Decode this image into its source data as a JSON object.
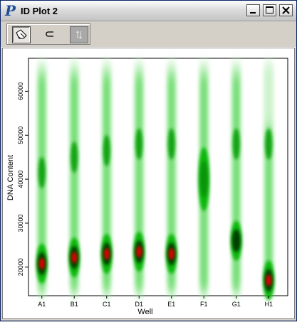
{
  "window": {
    "title": "ID Plot 2",
    "app_icon_letter": "P",
    "controls": [
      "minimize",
      "maximize",
      "close"
    ]
  },
  "toolbar": {
    "buttons": [
      {
        "name": "tag-tool",
        "icon": "hand-pencil-icon",
        "state": "active"
      },
      {
        "name": "gate-tool",
        "icon": "subset-icon",
        "state": "normal"
      },
      {
        "name": "arrows-tool",
        "icon": "vertical-arrows-icon",
        "state": "pressed"
      }
    ]
  },
  "chart_data": {
    "type": "heatmap",
    "subtype": "density strip plot",
    "xlabel": "Well",
    "ylabel": "DNA Content",
    "categories": [
      "A1",
      "B1",
      "C1",
      "D1",
      "E1",
      "F1",
      "G1",
      "H1"
    ],
    "ylim": [
      13500,
      67500
    ],
    "yticks": [
      20000,
      30000,
      40000,
      50000,
      60000
    ],
    "colormap": [
      "#ffffff",
      "#00d800",
      "#000000",
      "#ff0000"
    ],
    "peaks": [
      {
        "well": "A1",
        "g1_peak": 20800,
        "g2_peak": 41500
      },
      {
        "well": "B1",
        "g1_peak": 22200,
        "g2_peak": 45000
      },
      {
        "well": "C1",
        "g1_peak": 23000,
        "g2_peak": 46500
      },
      {
        "well": "D1",
        "g1_peak": 23500,
        "g2_peak": 48000
      },
      {
        "well": "E1",
        "g1_peak": 23000,
        "g2_peak": 48000
      },
      {
        "well": "F1",
        "g1_peak": 40000,
        "g2_peak": null
      },
      {
        "well": "G1",
        "g1_peak": 26000,
        "g2_peak": 48000
      },
      {
        "well": "H1",
        "g1_peak": 17000,
        "g2_peak": 48000
      }
    ]
  }
}
